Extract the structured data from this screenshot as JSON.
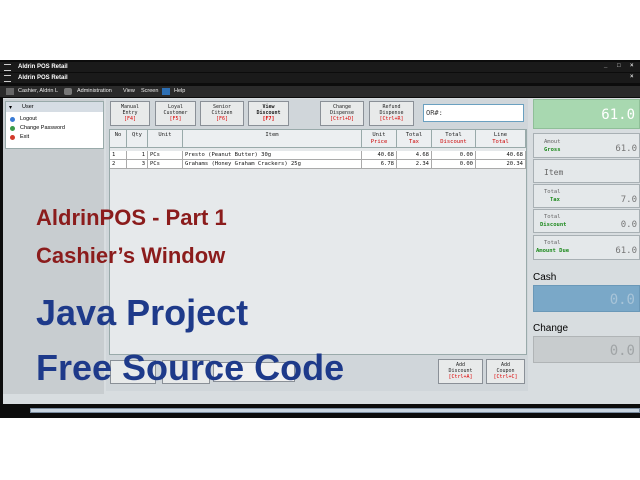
{
  "window": {
    "title_main": "Aldrin POS Retail",
    "title_child": "Aldrin POS Retail"
  },
  "menubar": {
    "user": "Cashier, Aldrin L",
    "items": [
      "Administration",
      "View",
      "Screen",
      "Help"
    ]
  },
  "user_panel": {
    "header": "User",
    "items": [
      "Logout",
      "Change Password",
      "Exit"
    ]
  },
  "toolbar": [
    {
      "l1": "Manual",
      "l2": "Entry",
      "key": "[F4]"
    },
    {
      "l1": "Loyal",
      "l2": "Customer",
      "key": "[F5]"
    },
    {
      "l1": "Senior",
      "l2": "Citizen",
      "key": "[F6]"
    },
    {
      "l1": "View",
      "l2": "Discount",
      "key": "[F7]"
    },
    {
      "l1": "Change",
      "l2": "Dispense",
      "key": "[Ctrl+D]"
    },
    {
      "l1": "Refund",
      "l2": "Dispense",
      "key": "[Ctrl+R]"
    }
  ],
  "or_field": {
    "value": "OR#:"
  },
  "table": {
    "headers": [
      {
        "top": "No",
        "bottom": ""
      },
      {
        "top": "Qty",
        "bottom": ""
      },
      {
        "top": "Unit",
        "bottom": ""
      },
      {
        "top": "Item",
        "bottom": ""
      },
      {
        "top": "Unit",
        "bottom": "Price"
      },
      {
        "top": "Total",
        "bottom": "Tax"
      },
      {
        "top": "Total",
        "bottom": "Discount"
      },
      {
        "top": "Line",
        "bottom": "Total"
      }
    ],
    "rows": [
      [
        "1",
        "1",
        "PCs",
        "Presto (Peanut Butter) 30g",
        "40.68",
        "4.68",
        "0.00",
        "40.68"
      ],
      [
        "2",
        "3",
        "PCs",
        "Grahams (Honey Graham Crackers) 25g",
        "6.78",
        "2.34",
        "0.00",
        "20.34"
      ]
    ]
  },
  "bottom_buttons": [
    {
      "l1": "Add",
      "l2": "Discount",
      "key": "[Ctrl+A]"
    },
    {
      "l1": "Add",
      "l2": "Coupon",
      "key": "[Ctrl+C]"
    }
  ],
  "summary": {
    "total": "61.0",
    "gross_label1": "Amout",
    "gross_label2": "Gross",
    "gross_value": "61.0",
    "item_label": "Item",
    "tax_label1": "Total",
    "tax_label2": "Tax",
    "tax_value": "7.0",
    "disc_label1": "Total",
    "disc_label2": "Discount",
    "disc_value": "0.0",
    "due_label1": "Total",
    "due_label2": "Amount Due",
    "due_value": "61.0",
    "cash_label": "Cash",
    "cash_value": "0.0",
    "change_label": "Change",
    "change_value": "0.0"
  },
  "overlay": {
    "line1": "AldrinPOS - Part 1",
    "line2": "Cashier’s Window",
    "line3": "Java Project",
    "line4": "Free Source Code"
  },
  "colors": {
    "accent_green": "#2e9a2e",
    "total_bar": "#a8d8b0",
    "cash_bar": "#7aa8c8",
    "overlay_red": "#8b1c1c",
    "overlay_blue": "#1e3a8a"
  }
}
